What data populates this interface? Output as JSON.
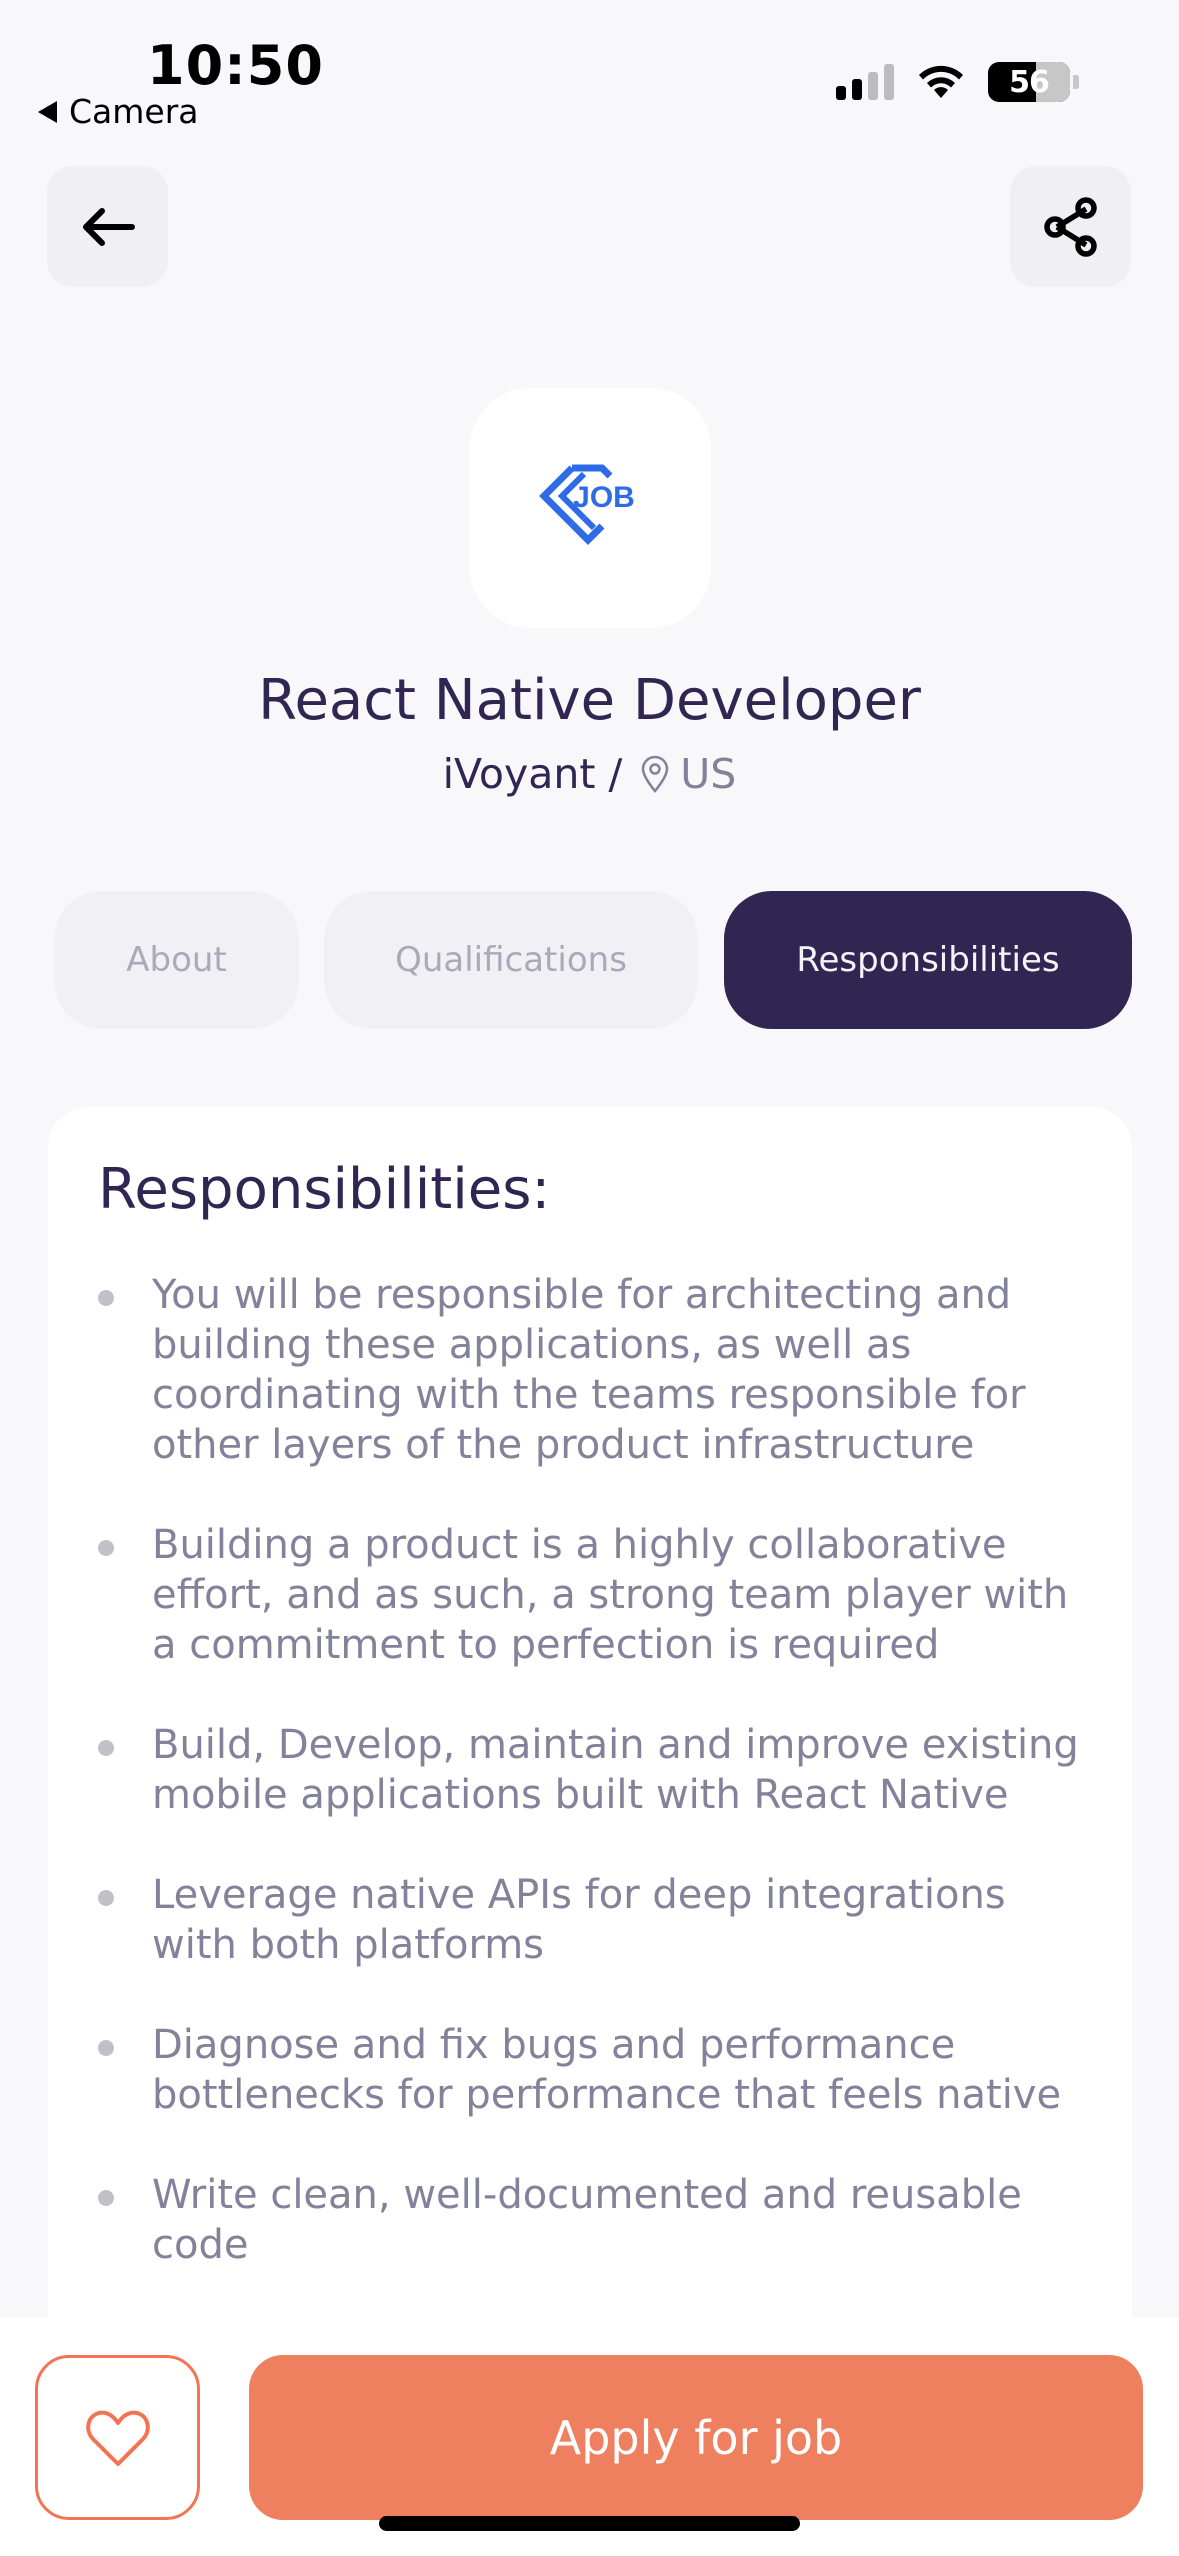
{
  "status_bar": {
    "time": "10:50",
    "back_app": "Camera",
    "battery_percent": "56",
    "signal_icon": "cellular-signal-icon",
    "wifi_icon": "wifi-icon"
  },
  "header": {
    "back_icon": "arrow-left-icon",
    "share_icon": "share-icon"
  },
  "job": {
    "logo_text": "JOB",
    "title": "React Native Developer",
    "company": "iVoyant /",
    "location": "US",
    "location_icon": "location-pin-icon"
  },
  "tabs": [
    {
      "label": "About",
      "active": false
    },
    {
      "label": "Qualifications",
      "active": false
    },
    {
      "label": "Responsibilities",
      "active": true
    }
  ],
  "section": {
    "title": "Responsibilities:",
    "items": [
      "You will be responsible for architecting and building these applications, as well as coordinating with the teams responsible for other layers of the product infrastructure",
      "Building a product is a highly collaborative effort, and as such, a strong team player with a commitment to perfection is required",
      "Build, Develop, maintain and improve existing mobile applications built with React Native",
      "Leverage native APIs for deep integrations with both platforms",
      "Diagnose and fix bugs and performance bottlenecks for performance that feels native",
      "Write clean, well-documented and reusable code"
    ]
  },
  "footer": {
    "like_icon": "heart-icon",
    "apply_label": "Apply for job"
  },
  "colors": {
    "primary": "#312651",
    "accent": "#EE805F",
    "gray": "#83829A",
    "background": "#F8F8FB"
  }
}
